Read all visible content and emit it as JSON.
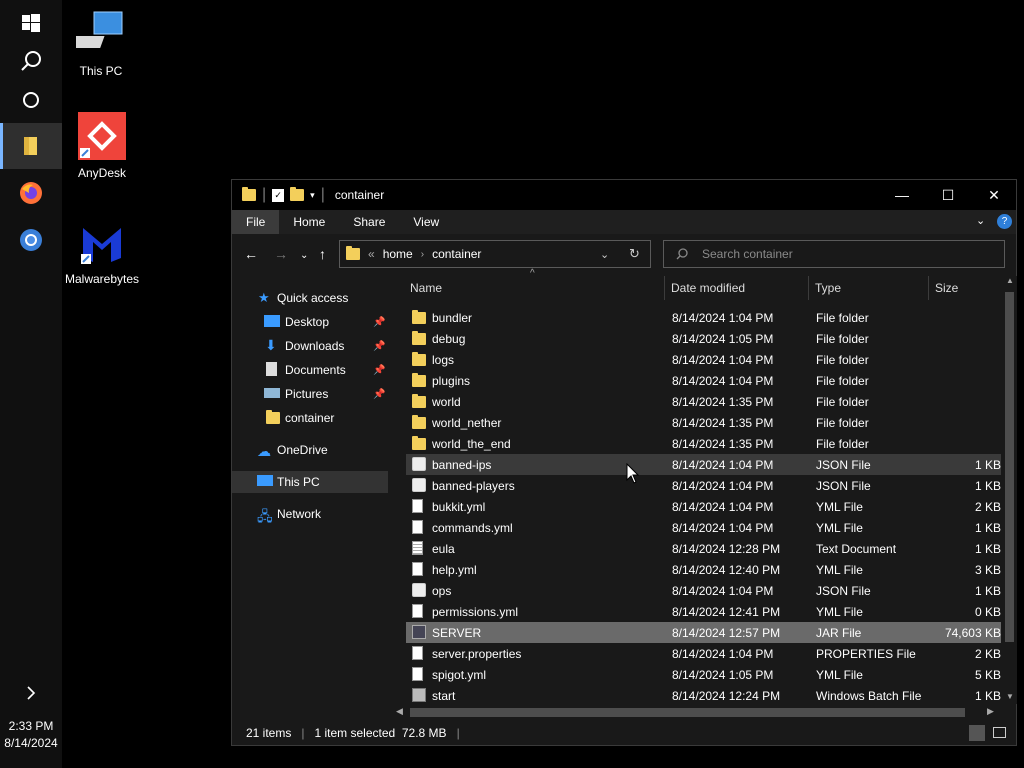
{
  "taskbar": {
    "time": "2:33 PM",
    "date": "8/14/2024",
    "icons": [
      "windows-start-icon",
      "search-icon",
      "cortana-icon",
      "file-explorer-icon",
      "firefox-icon",
      "chrome-icon",
      "chevron-right-icon"
    ]
  },
  "desktop": {
    "icons": [
      {
        "label": "This PC",
        "icon": "computer-icon"
      },
      {
        "label": "AnyDesk",
        "icon": "anydesk-icon"
      },
      {
        "label": "Malwarebytes",
        "icon": "malwarebytes-icon"
      }
    ]
  },
  "window": {
    "title": "container",
    "ribbon_tabs": [
      "File",
      "Home",
      "Share",
      "View"
    ],
    "breadcrumb": [
      "home",
      "container"
    ],
    "breadcrumb_prefix": "«",
    "search_placeholder": "Search container",
    "controls": {
      "minimize": "—",
      "maximize": "☐",
      "close": "✕"
    }
  },
  "nav": {
    "quick_access": "Quick access",
    "items": [
      {
        "label": "Desktop",
        "pinned": true
      },
      {
        "label": "Downloads",
        "pinned": true
      },
      {
        "label": "Documents",
        "pinned": true
      },
      {
        "label": "Pictures",
        "pinned": true
      },
      {
        "label": "container",
        "pinned": false
      }
    ],
    "onedrive": "OneDrive",
    "thispc": "This PC",
    "network": "Network"
  },
  "columns": {
    "name": "Name",
    "date": "Date modified",
    "type": "Type",
    "size": "Size"
  },
  "files": [
    {
      "name": "bundler",
      "date": "8/14/2024 1:04 PM",
      "type": "File folder",
      "size": "",
      "kind": "folder"
    },
    {
      "name": "debug",
      "date": "8/14/2024 1:05 PM",
      "type": "File folder",
      "size": "",
      "kind": "folder"
    },
    {
      "name": "logs",
      "date": "8/14/2024 1:04 PM",
      "type": "File folder",
      "size": "",
      "kind": "folder"
    },
    {
      "name": "plugins",
      "date": "8/14/2024 1:04 PM",
      "type": "File folder",
      "size": "",
      "kind": "folder"
    },
    {
      "name": "world",
      "date": "8/14/2024 1:35 PM",
      "type": "File folder",
      "size": "",
      "kind": "folder"
    },
    {
      "name": "world_nether",
      "date": "8/14/2024 1:35 PM",
      "type": "File folder",
      "size": "",
      "kind": "folder"
    },
    {
      "name": "world_the_end",
      "date": "8/14/2024 1:35 PM",
      "type": "File folder",
      "size": "",
      "kind": "folder"
    },
    {
      "name": "banned-ips",
      "date": "8/14/2024 1:04 PM",
      "type": "JSON File",
      "size": "1 KB",
      "kind": "json"
    },
    {
      "name": "banned-players",
      "date": "8/14/2024 1:04 PM",
      "type": "JSON File",
      "size": "1 KB",
      "kind": "json"
    },
    {
      "name": "bukkit.yml",
      "date": "8/14/2024 1:04 PM",
      "type": "YML File",
      "size": "2 KB",
      "kind": "file"
    },
    {
      "name": "commands.yml",
      "date": "8/14/2024 1:04 PM",
      "type": "YML File",
      "size": "1 KB",
      "kind": "file"
    },
    {
      "name": "eula",
      "date": "8/14/2024 12:28 PM",
      "type": "Text Document",
      "size": "1 KB",
      "kind": "text"
    },
    {
      "name": "help.yml",
      "date": "8/14/2024 12:40 PM",
      "type": "YML File",
      "size": "3 KB",
      "kind": "file"
    },
    {
      "name": "ops",
      "date": "8/14/2024 1:04 PM",
      "type": "JSON File",
      "size": "1 KB",
      "kind": "json"
    },
    {
      "name": "permissions.yml",
      "date": "8/14/2024 12:41 PM",
      "type": "YML File",
      "size": "0 KB",
      "kind": "file"
    },
    {
      "name": "SERVER",
      "date": "8/14/2024 12:57 PM",
      "type": "JAR File",
      "size": "74,603 KB",
      "kind": "jar"
    },
    {
      "name": "server.properties",
      "date": "8/14/2024 1:04 PM",
      "type": "PROPERTIES File",
      "size": "2 KB",
      "kind": "file"
    },
    {
      "name": "spigot.yml",
      "date": "8/14/2024 1:05 PM",
      "type": "YML File",
      "size": "5 KB",
      "kind": "file"
    },
    {
      "name": "start",
      "date": "8/14/2024 12:24 PM",
      "type": "Windows Batch File",
      "size": "1 KB",
      "kind": "bat"
    }
  ],
  "hover_index": 7,
  "selected_index": 15,
  "status": {
    "count": "21 items",
    "selection": "1 item selected  72.8 MB"
  }
}
